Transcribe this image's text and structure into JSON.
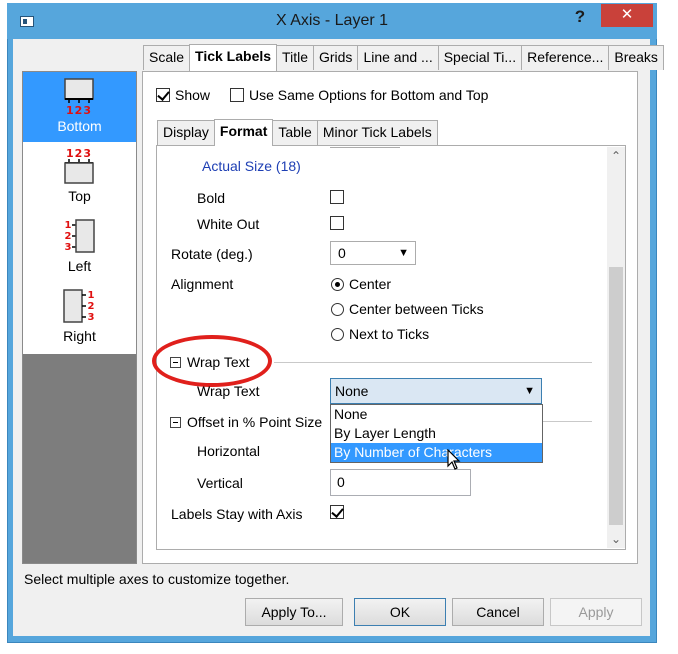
{
  "window": {
    "title": "X Axis - Layer 1",
    "help_label": "?",
    "close_label": "✕"
  },
  "axis_list": [
    {
      "label": "Bottom",
      "glyph_text": "123",
      "selected": true
    },
    {
      "label": "Top",
      "glyph_text": "123",
      "selected": false
    },
    {
      "label": "Left",
      "glyph_text": "123",
      "selected": false
    },
    {
      "label": "Right",
      "glyph_text": "123",
      "selected": false
    }
  ],
  "tabs": [
    {
      "label": "Scale",
      "active": false
    },
    {
      "label": "Tick Labels",
      "active": true
    },
    {
      "label": "Title",
      "active": false
    },
    {
      "label": "Grids",
      "active": false
    },
    {
      "label": "Line and ...",
      "active": false
    },
    {
      "label": "Special Ti...",
      "active": false
    },
    {
      "label": "Reference...",
      "active": false
    },
    {
      "label": "Breaks",
      "active": false
    }
  ],
  "show": {
    "label": "Show",
    "checked": true
  },
  "same_options": {
    "label": "Use Same Options for Bottom and Top",
    "checked": false
  },
  "inner_tabs": [
    {
      "label": "Display",
      "active": false
    },
    {
      "label": "Format",
      "active": true
    },
    {
      "label": "Table",
      "active": false
    },
    {
      "label": "Minor Tick Labels",
      "active": false
    }
  ],
  "format": {
    "actual_size": "Actual Size (18)",
    "bold_label": "Bold",
    "bold_checked": false,
    "white_out_label": "White Out",
    "white_out_checked": false,
    "rotate_label": "Rotate (deg.)",
    "rotate_value": "0",
    "alignment_label": "Alignment",
    "alignment_options": [
      "Center",
      "Center between Ticks",
      "Next to Ticks"
    ],
    "alignment_selected": "Center",
    "wrap_section": "Wrap Text",
    "wrap_label": "Wrap Text",
    "wrap_value": "None",
    "wrap_options": [
      "None",
      "By Layer Length",
      "By Number of Characters"
    ],
    "wrap_highlighted": "By Number of Characters",
    "offset_section": "Offset in % Point Size",
    "horizontal_label": "Horizontal",
    "vertical_label": "Vertical",
    "vertical_value": "0",
    "labels_stay_label": "Labels Stay with Axis",
    "labels_stay_checked": true
  },
  "status_text": "Select multiple axes to customize together.",
  "buttons": {
    "apply_to": "Apply To...",
    "ok": "OK",
    "cancel": "Cancel",
    "apply": "Apply"
  },
  "colors": {
    "titlebar": "#56a6dc",
    "selection": "#3399ff",
    "close": "#c9413a",
    "annotation": "#e0201c",
    "link_text": "#1e3fb4",
    "glyph_red": "#e01010"
  }
}
